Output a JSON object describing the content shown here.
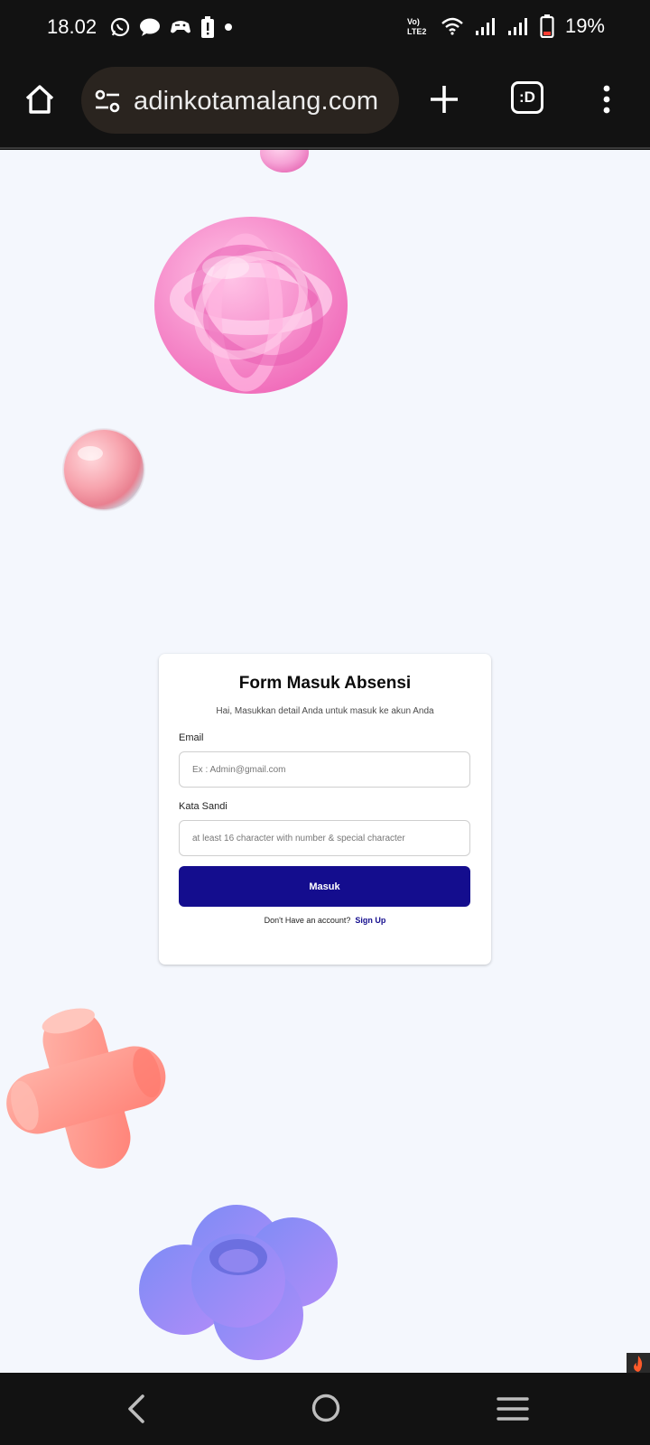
{
  "status_bar": {
    "time": "18.02",
    "battery": "19%",
    "notification_icons": [
      "whatsapp-icon",
      "message-icon",
      "game-controller-icon",
      "battery-alert-icon",
      "dot-icon"
    ],
    "status_icons": [
      "volte-icon",
      "wifi-icon",
      "signal-icon",
      "signal-icon",
      "battery-icon"
    ]
  },
  "browser": {
    "url": "adinkotamalang.com",
    "tab_switcher_label": ":D"
  },
  "login_card": {
    "title": "Form Masuk Absensi",
    "subtitle": "Hai, Masukkan detail Anda untuk masuk ke akun Anda",
    "email_label": "Email",
    "email_placeholder": "Ex : Admin@gmail.com",
    "email_value": "",
    "password_label": "Kata Sandi",
    "password_placeholder": "at least 16 character with number & special character",
    "password_value": "",
    "submit_label": "Masuk",
    "signup_prompt": "Don't Have an account?",
    "signup_link": "Sign Up"
  },
  "colors": {
    "page_background": "#f4f7fd",
    "primary_button": "#140d8e",
    "link": "#140d8e",
    "pink_decoration": "#f78bc8",
    "coral_decoration": "#ff9a8a",
    "purple_decoration": "#8f8cf5"
  },
  "nav_icons": [
    "back-icon",
    "home-icon",
    "recents-icon"
  ]
}
